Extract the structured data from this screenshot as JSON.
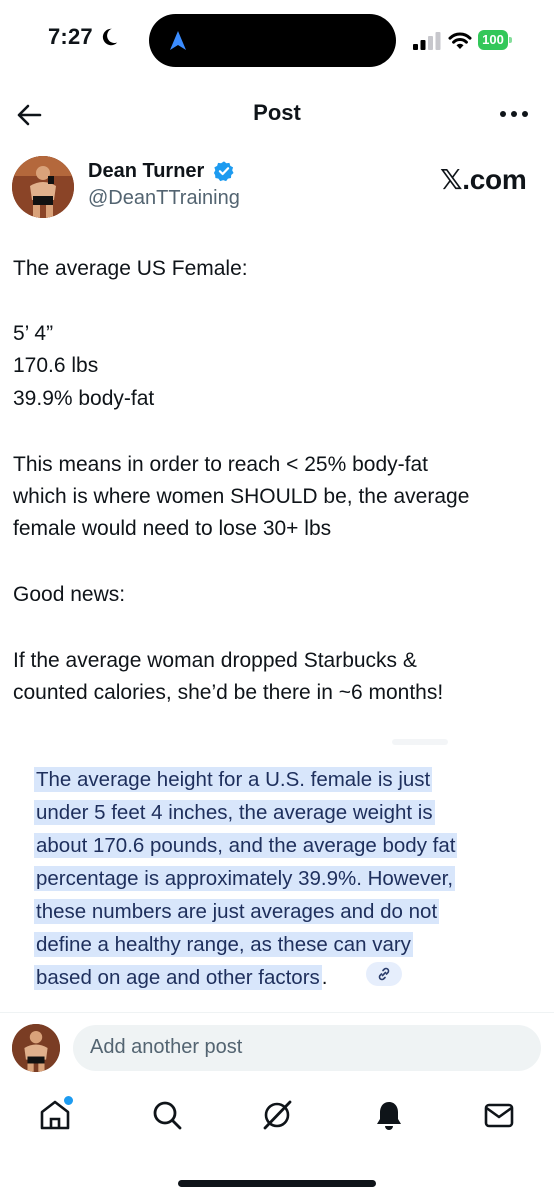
{
  "status_bar": {
    "time": "7:27",
    "battery": "100",
    "icons": [
      "moon-icon",
      "navigation-arrow-icon",
      "signal-icon",
      "wifi-icon",
      "battery-icon"
    ]
  },
  "header": {
    "title": "Post",
    "back_icon": "arrow-left-icon",
    "more_icon": "more-horizontal-icon"
  },
  "post": {
    "author_name": "Dean Turner",
    "author_handle": "@DeanTTraining",
    "source": "𝕏.com",
    "verified_color": "#1d9bf0",
    "lines": [
      "The average US Female:",
      "5’ 4”",
      "170.6 lbs",
      "39.9% body-fat",
      "This means in order to reach < 25% body-fat",
      "which is where women SHOULD be, the average",
      "female would need to lose 30+ lbs",
      "Good news:",
      "If the average woman dropped Starbucks &",
      "counted calories, she’d be there in ~6 months!"
    ]
  },
  "quote": {
    "lines": [
      "The average height for a U.S. female is just",
      "under 5 feet 4 inches, the average weight is",
      "about 170.6 pounds, and the average body fat",
      "percentage is approximately 39.9%. However,",
      "these numbers are just averages and do not",
      "define a healthy range, as these can vary",
      "based on age and other factors"
    ],
    "trailing_period": ".",
    "highlight_color": "#d8e6fb",
    "link_icon": "link-icon"
  },
  "reply": {
    "placeholder": "Add another post"
  },
  "tabbar": {
    "items": [
      "home-icon",
      "search-icon",
      "grok-icon",
      "notifications-icon",
      "messages-icon"
    ],
    "accent": "#1d9bf0"
  }
}
